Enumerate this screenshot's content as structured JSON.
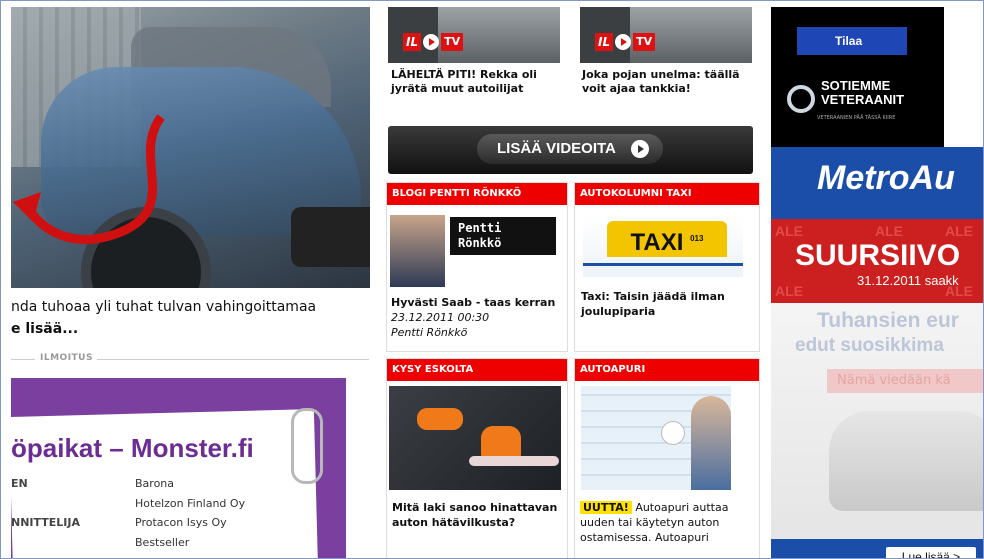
{
  "hero": {
    "caption": "nda tuhoaa yli tuhat tulvan vahingoittamaa",
    "read_more": "e lisää..."
  },
  "ad_label": "ILMOITUS",
  "monster_ad": {
    "title": "öpaikat – Monster.fi",
    "rows": [
      {
        "left": "EN",
        "right": "Barona"
      },
      {
        "left": "",
        "right": "Hotelzon Finland Oy"
      },
      {
        "left": "NNITTELIJA",
        "right": "Protacon Isys Oy"
      },
      {
        "left": "",
        "right": "Bestseller"
      }
    ]
  },
  "videos": [
    {
      "badge_il": "IL",
      "badge_tv": "TV",
      "title": "LÄHELTÄ PITI! Rekka oli jyrätä muut autoilijat"
    },
    {
      "badge_il": "IL",
      "badge_tv": "TV",
      "title": "Joka pojan unelma: täällä voit ajaa tankkia!"
    }
  ],
  "more_videos_label": "LISÄÄ VIDEOITA",
  "boxes": {
    "blog": {
      "header": "BLOGI PENTTI RÖNKKÖ",
      "bubble_first": "Pentti",
      "bubble_last": "Rönkkö",
      "title": "Hyvästi Saab - taas kerran",
      "date": "23.12.2011 00:30",
      "author": "Pentti Rönkkö"
    },
    "taxi": {
      "header": "AUTOKOLUMNI TAXI",
      "sign": "TAXI",
      "sign_number": "013",
      "title": "Taxi: Taisin jäädä ilman joulupiparia"
    },
    "esko": {
      "header": "KYSY ESKOLTA",
      "title": "Mitä laki sanoo hinattavan auton hätävilkusta?"
    },
    "autoapuri": {
      "header": "AUTOAPURI",
      "badge": "UUTTA!",
      "text": "Autoapuri auttaa uuden tai käytetyn auton ostamisessa. Autoapuri"
    }
  },
  "right_ads": {
    "subscribe": "Tilaa",
    "veterans_line1": "SOTIEMME",
    "veterans_line2": "VETERAANIT",
    "veterans_sub": "VETERAANIEN PÄÄ TÄSSÄ KIIRE",
    "brand": "MetroAu",
    "sale_word": "ALE",
    "sale_big": "SUURSIIVO",
    "sale_date": "31.12.2011 saakk",
    "lower_line1": "Tuhansien eur",
    "lower_line2": "edut suosikkima",
    "lower_pill": "Nämä viedään kä",
    "read_more": "Lue lisää >"
  }
}
